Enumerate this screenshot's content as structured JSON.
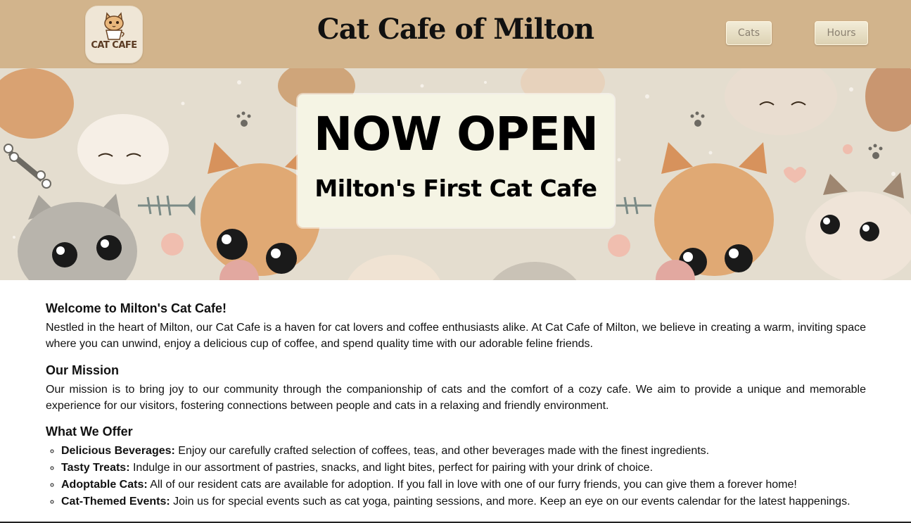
{
  "header": {
    "logo_text": "CAT CAFE",
    "title": "Cat Cafe of Milton",
    "nav": [
      {
        "label": "Cats"
      },
      {
        "label": "Hours"
      }
    ]
  },
  "banner": {
    "headline": "NOW OPEN",
    "subheadline": "Milton's First Cat Cafe"
  },
  "welcome": {
    "heading": "Welcome to Milton's Cat Cafe!",
    "text": "Nestled in the heart of Milton, our Cat Cafe is a haven for cat lovers and coffee enthusiasts alike. At Cat Cafe of Milton, we believe in creating a warm, inviting space where you can unwind, enjoy a delicious cup of coffee, and spend quality time with our adorable feline friends."
  },
  "mission": {
    "heading": "Our Mission",
    "text": "Our mission is to bring joy to our community through the companionship of cats and the comfort of a cozy cafe. We aim to provide a unique and memorable experience for our visitors, fostering connections between people and cats in a relaxing and friendly environment."
  },
  "offer": {
    "heading": "What We Offer",
    "items": [
      {
        "title": "Delicious Beverages:",
        "text": " Enjoy our carefully crafted selection of coffees, teas, and other beverages made with the finest ingredients."
      },
      {
        "title": "Tasty Treats:",
        "text": " Indulge in our assortment of pastries, snacks, and light bites, perfect for pairing with your drink of choice."
      },
      {
        "title": "Adoptable Cats:",
        "text": " All of our resident cats are available for adoption. If you fall in love with one of our furry friends, you can give them a forever home!"
      },
      {
        "title": "Cat-Themed Events:",
        "text": " Join us for special events such as cat yoga, painting sessions, and more. Keep an eye on our events calendar for the latest happenings."
      }
    ]
  },
  "colors": {
    "header_bg": "#d2b48c",
    "banner_box_bg": "#f5f4e4"
  }
}
